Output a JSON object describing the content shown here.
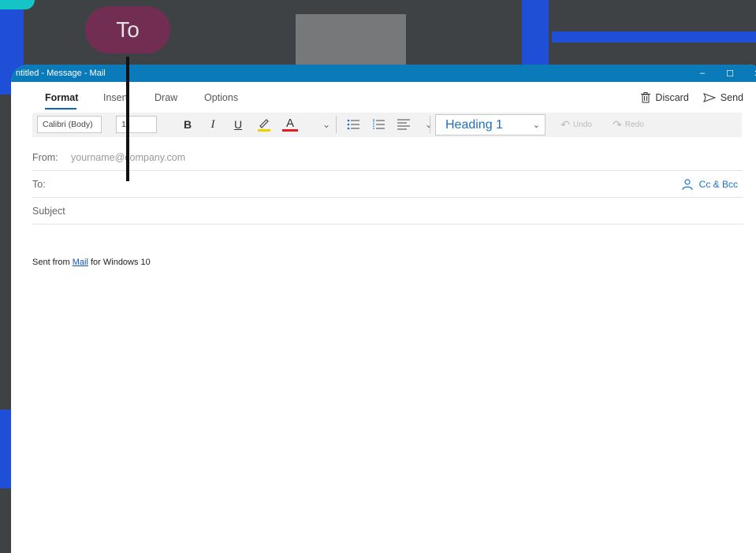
{
  "window": {
    "title": "ntitled - Message - Mail",
    "controls": [
      "–",
      "☐",
      "✕"
    ]
  },
  "menu": {
    "tabs": [
      "Format",
      "Insert",
      "Draw",
      "Options"
    ],
    "active_tab": "Format",
    "discard_label": "Discard",
    "send_label": "Send"
  },
  "toolbar": {
    "font_family": "Calibri (Body)",
    "font_size": "11",
    "bold": "B",
    "italic": "I",
    "underline": "U",
    "font_color_letter": "A",
    "chevron": "⌄",
    "style": "Heading 1",
    "undo_label": "Undo",
    "redo_label": "Redo",
    "highlight_color": "#f2d000",
    "font_color": "#e02020"
  },
  "fields": {
    "from_label": "From:",
    "from_value": "yourname@company.com",
    "to_label": "To:",
    "cc_label": "Cc & Bcc",
    "subject_placeholder": "Subject"
  },
  "body": {
    "sig_prefix": "Sent from ",
    "sig_link": "Mail",
    "sig_suffix": " for Windows 10"
  },
  "callout": {
    "text": "To"
  },
  "colors": {
    "titlebar": "#0a7ab8",
    "accent": "#1a73c9",
    "callout": "#7a2a55",
    "background_stripe": "#1f4fd6"
  }
}
